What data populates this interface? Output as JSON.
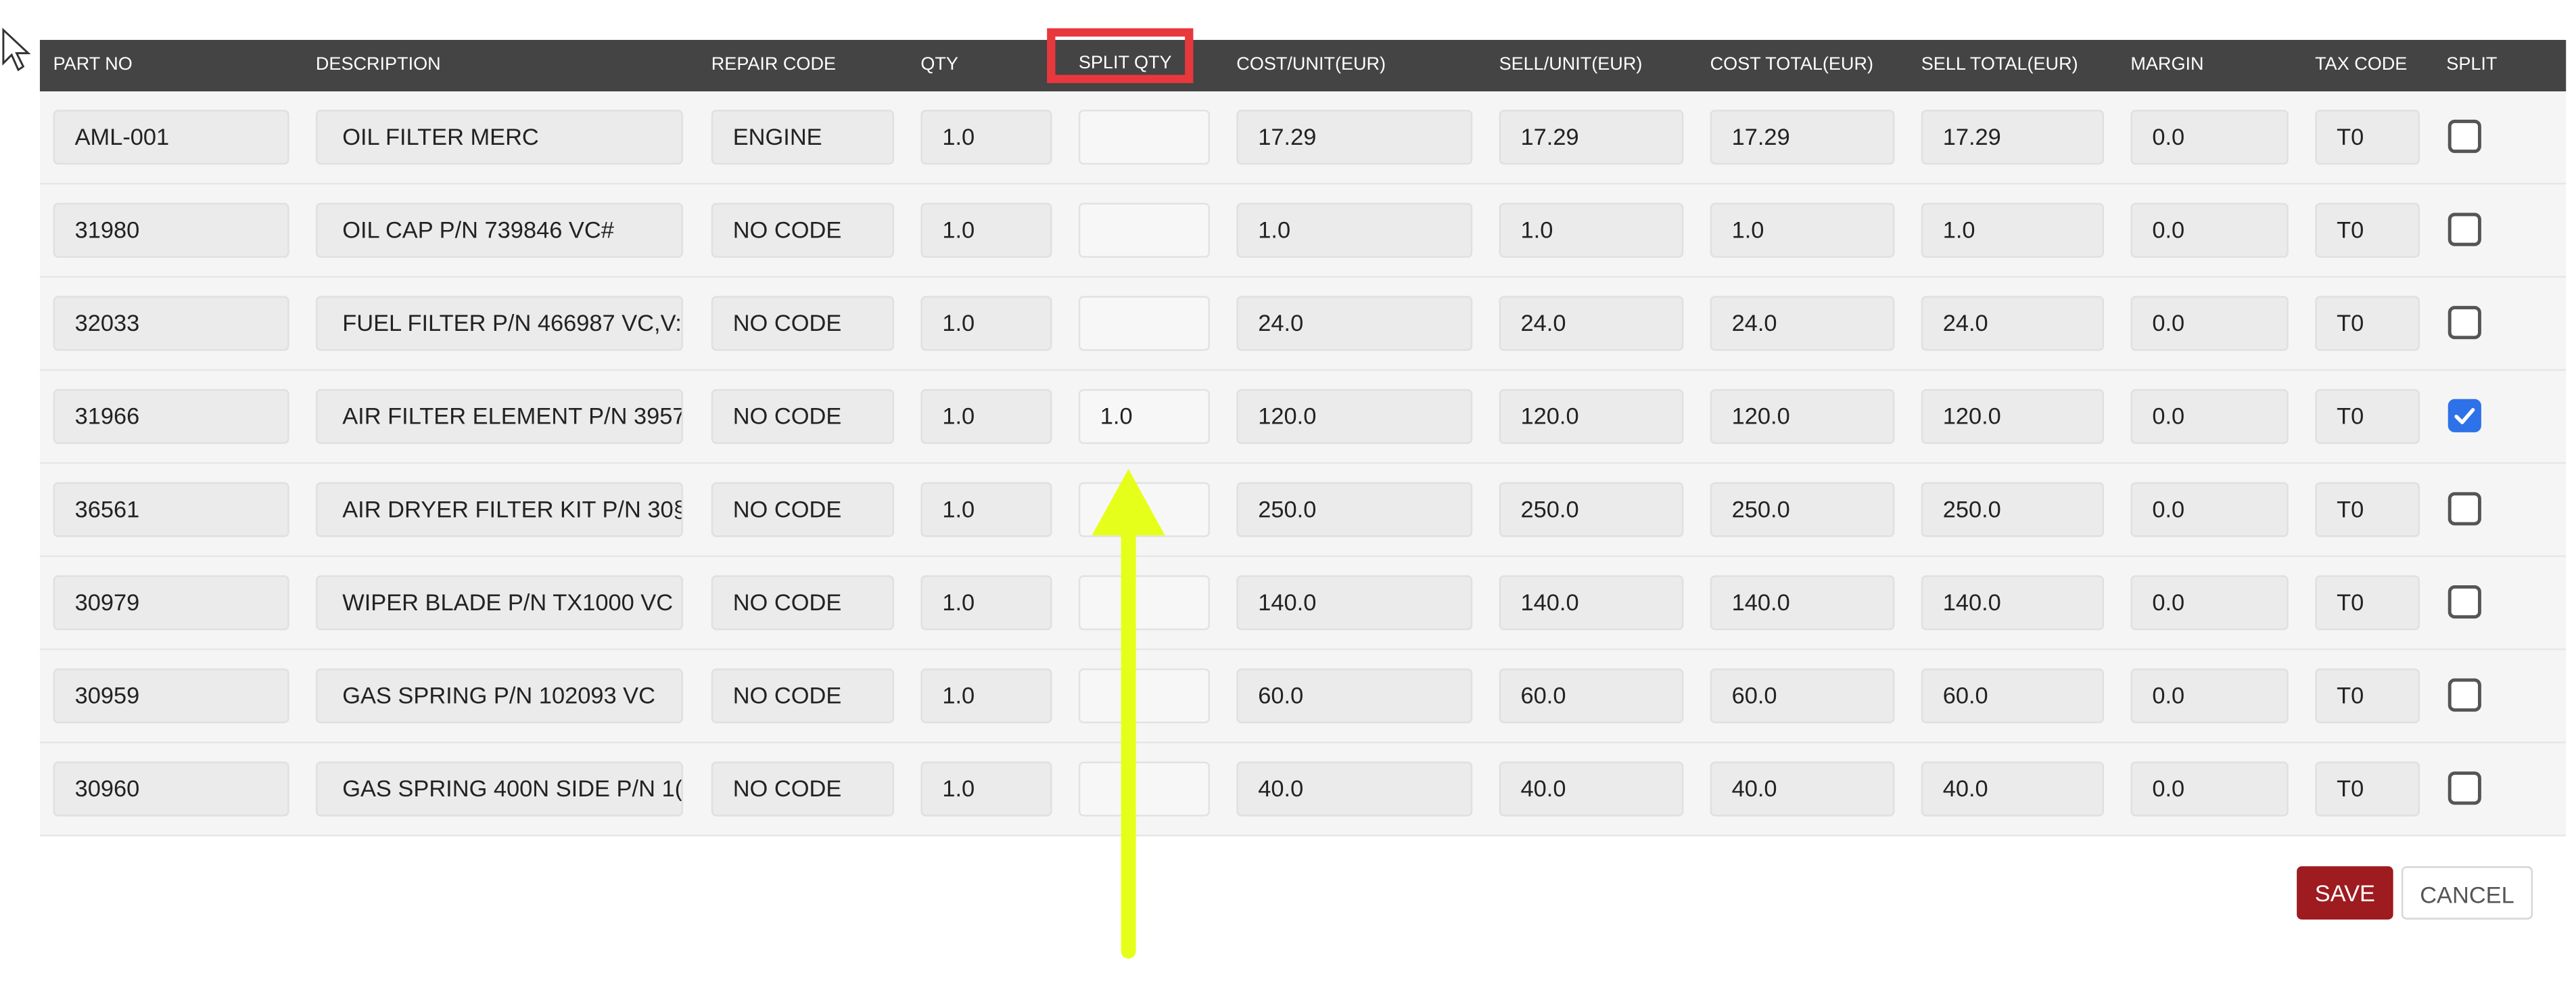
{
  "header": {
    "part_no": "PART NO",
    "description": "DESCRIPTION",
    "repair_code": "REPAIR CODE",
    "qty": "QTY",
    "split_qty": "SPLIT QTY",
    "cost_unit": "COST/UNIT(EUR)",
    "sell_unit": "SELL/UNIT(EUR)",
    "cost_total": "COST TOTAL(EUR)",
    "sell_total": "SELL TOTAL(EUR)",
    "margin": "MARGIN",
    "tax_code": "TAX CODE",
    "split": "SPLIT"
  },
  "rows": [
    {
      "part_no": "AML-001",
      "description": "OIL FILTER MERC",
      "repair_code": "ENGINE",
      "qty": "1.0",
      "split_qty": "",
      "cost_unit": "17.29",
      "sell_unit": "17.29",
      "cost_total": "17.29",
      "sell_total": "17.29",
      "margin": "0.0",
      "tax_code": "T0",
      "split_checked": false
    },
    {
      "part_no": "31980",
      "description": "OIL CAP P/N 739846 VC#",
      "repair_code": "NO CODE",
      "qty": "1.0",
      "split_qty": "",
      "cost_unit": "1.0",
      "sell_unit": "1.0",
      "cost_total": "1.0",
      "sell_total": "1.0",
      "margin": "0.0",
      "tax_code": "T0",
      "split_checked": false
    },
    {
      "part_no": "32033",
      "description": "FUEL FILTER P/N 466987 VC,V:",
      "repair_code": "NO CODE",
      "qty": "1.0",
      "split_qty": "",
      "cost_unit": "24.0",
      "sell_unit": "24.0",
      "cost_total": "24.0",
      "sell_total": "24.0",
      "margin": "0.0",
      "tax_code": "T0",
      "split_checked": false
    },
    {
      "part_no": "31966",
      "description": "AIR FILTER ELEMENT P/N 3957",
      "repair_code": "NO CODE",
      "qty": "1.0",
      "split_qty": "1.0",
      "cost_unit": "120.0",
      "sell_unit": "120.0",
      "cost_total": "120.0",
      "sell_total": "120.0",
      "margin": "0.0",
      "tax_code": "T0",
      "split_checked": true
    },
    {
      "part_no": "36561",
      "description": "AIR DRYER FILTER KIT P/N 30§",
      "repair_code": "NO CODE",
      "qty": "1.0",
      "split_qty": "",
      "cost_unit": "250.0",
      "sell_unit": "250.0",
      "cost_total": "250.0",
      "sell_total": "250.0",
      "margin": "0.0",
      "tax_code": "T0",
      "split_checked": false
    },
    {
      "part_no": "30979",
      "description": "WIPER BLADE P/N TX1000 VC",
      "repair_code": "NO CODE",
      "qty": "1.0",
      "split_qty": "",
      "cost_unit": "140.0",
      "sell_unit": "140.0",
      "cost_total": "140.0",
      "sell_total": "140.0",
      "margin": "0.0",
      "tax_code": "T0",
      "split_checked": false
    },
    {
      "part_no": "30959",
      "description": "GAS SPRING P/N 102093 VC",
      "repair_code": "NO CODE",
      "qty": "1.0",
      "split_qty": "",
      "cost_unit": "60.0",
      "sell_unit": "60.0",
      "cost_total": "60.0",
      "sell_total": "60.0",
      "margin": "0.0",
      "tax_code": "T0",
      "split_checked": false
    },
    {
      "part_no": "30960",
      "description": "GAS SPRING 400N SIDE P/N 1(",
      "repair_code": "NO CODE",
      "qty": "1.0",
      "split_qty": "",
      "cost_unit": "40.0",
      "sell_unit": "40.0",
      "cost_total": "40.0",
      "sell_total": "40.0",
      "margin": "0.0",
      "tax_code": "T0",
      "split_checked": false
    }
  ],
  "actions": {
    "save_label": "SAVE",
    "cancel_label": "CANCEL"
  },
  "icons": {
    "cursor": "mouse-pointer-icon",
    "arrow": "annotation-arrow-up-icon",
    "checkbox_tick": "checkmark-icon"
  },
  "colors": {
    "header_bg": "#444444",
    "highlight_border": "#e8383d",
    "save_bg": "#9e1b1f",
    "checkbox_checked": "#2d72e8",
    "annotation_arrow": "#e6ff1a"
  }
}
